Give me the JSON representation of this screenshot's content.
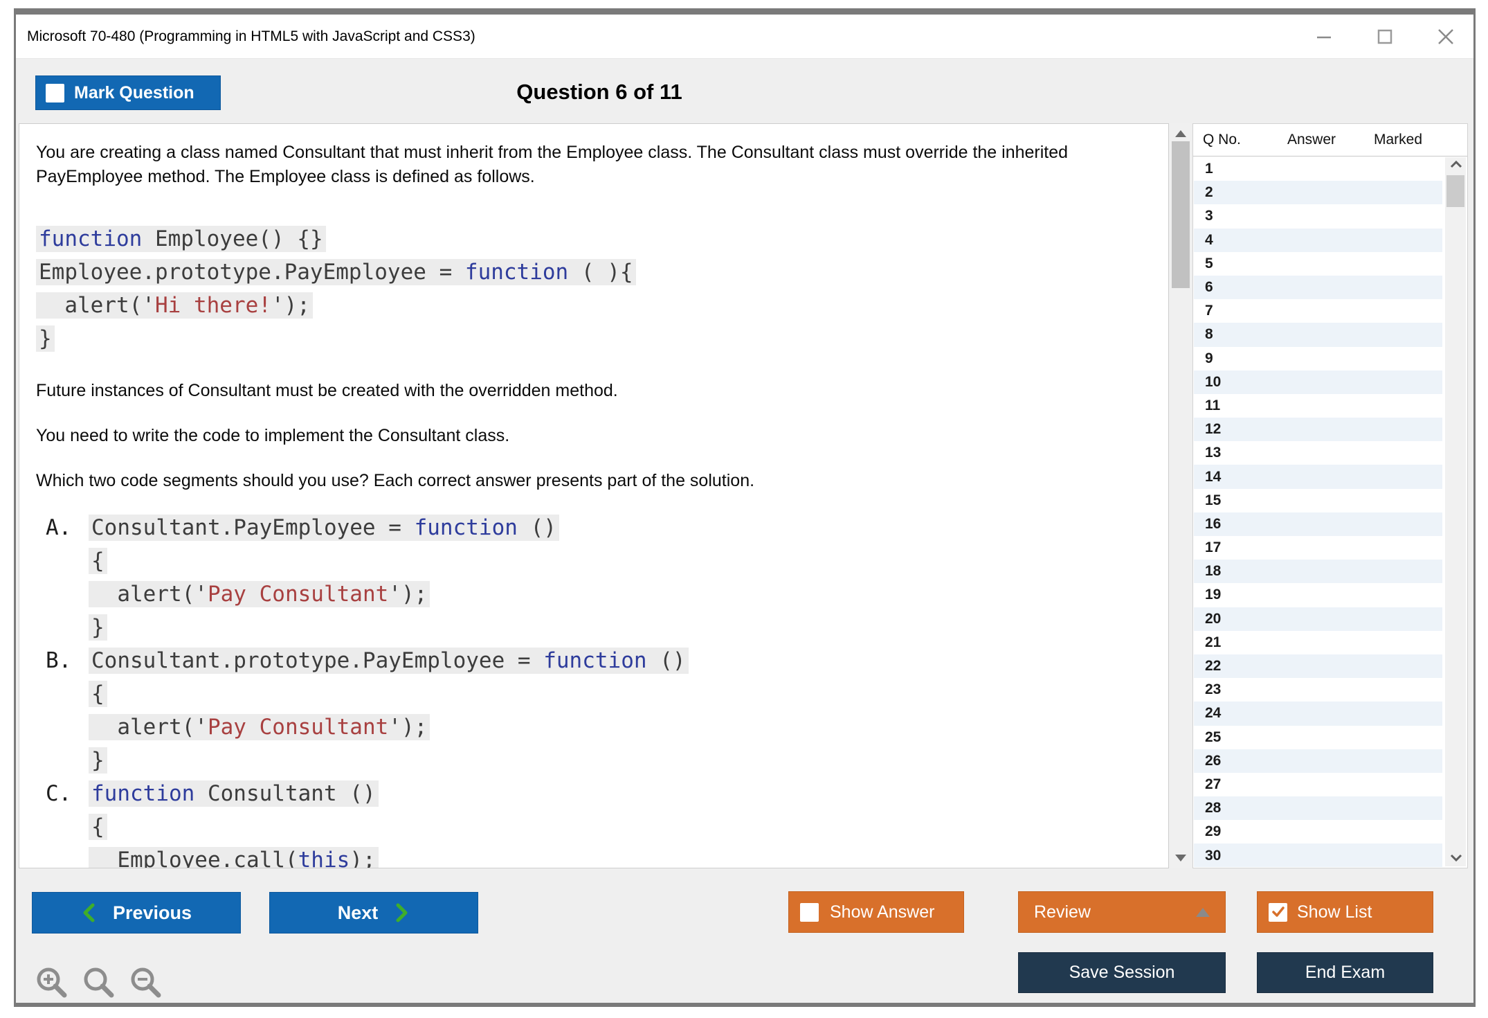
{
  "window": {
    "title": "Microsoft 70-480 (Programming in HTML5 with JavaScript and CSS3)"
  },
  "header": {
    "mark_question": "Mark Question",
    "question_counter": "Question 6 of 11"
  },
  "question": {
    "intro": "You are creating a class named Consultant that must inherit from the Employee class. The Consultant class must override the inherited PayEmployee method. The Employee class is defined as follows.",
    "code": [
      [
        {
          "t": "function",
          "c": "kw"
        },
        {
          "t": " Employee() {}",
          "c": "pl"
        }
      ],
      [
        {
          "t": "Employee.prototype.PayEmployee = ",
          "c": "pl"
        },
        {
          "t": "function",
          "c": "kw"
        },
        {
          "t": " ( ){",
          "c": "pl"
        }
      ],
      [
        {
          "t": "  alert('",
          "c": "pl"
        },
        {
          "t": "Hi there!",
          "c": "str"
        },
        {
          "t": "');",
          "c": "pl"
        }
      ],
      [
        {
          "t": "}",
          "c": "pl"
        }
      ]
    ],
    "para_future": "Future instances of Consultant must be created with the overridden method.",
    "para_need": "You need to write the code to implement the Consultant class.",
    "para_which": "Which two code segments should you use? Each correct answer presents part of the solution.",
    "options": [
      {
        "label": "A.",
        "lines": [
          [
            {
              "t": "Consultant.PayEmployee = ",
              "c": "pl"
            },
            {
              "t": "function",
              "c": "kw"
            },
            {
              "t": " ()",
              "c": "pl"
            }
          ],
          [
            {
              "t": "{",
              "c": "pl"
            }
          ],
          [
            {
              "t": "  alert('",
              "c": "pl"
            },
            {
              "t": "Pay Consultant",
              "c": "str"
            },
            {
              "t": "');",
              "c": "pl"
            }
          ],
          [
            {
              "t": "}",
              "c": "pl"
            }
          ]
        ]
      },
      {
        "label": "B.",
        "lines": [
          [
            {
              "t": "Consultant.prototype.PayEmployee = ",
              "c": "pl"
            },
            {
              "t": "function",
              "c": "kw"
            },
            {
              "t": " ()",
              "c": "pl"
            }
          ],
          [
            {
              "t": "{",
              "c": "pl"
            }
          ],
          [
            {
              "t": "  alert('",
              "c": "pl"
            },
            {
              "t": "Pay Consultant",
              "c": "str"
            },
            {
              "t": "');",
              "c": "pl"
            }
          ],
          [
            {
              "t": "}",
              "c": "pl"
            }
          ]
        ]
      },
      {
        "label": "C.",
        "lines": [
          [
            {
              "t": "function",
              "c": "kw"
            },
            {
              "t": " Consultant ()",
              "c": "pl"
            }
          ],
          [
            {
              "t": "{",
              "c": "pl"
            }
          ],
          [
            {
              "t": "  Employee.call(",
              "c": "pl"
            },
            {
              "t": "this",
              "c": "kw"
            },
            {
              "t": ");",
              "c": "pl"
            }
          ]
        ]
      }
    ]
  },
  "sidebar": {
    "columns": [
      "Q No.",
      "Answer",
      "Marked"
    ],
    "question_numbers": [
      1,
      2,
      3,
      4,
      5,
      6,
      7,
      8,
      9,
      10,
      11,
      12,
      13,
      14,
      15,
      16,
      17,
      18,
      19,
      20,
      21,
      22,
      23,
      24,
      25,
      26,
      27,
      28,
      29,
      30
    ]
  },
  "footer": {
    "previous": "Previous",
    "next": "Next",
    "show_answer": "Show Answer",
    "review": "Review",
    "show_list": "Show List",
    "save_session": "Save Session",
    "end_exam": "End Exam"
  },
  "colors": {
    "accent_blue": "#1268b3",
    "accent_orange": "#d8702b",
    "navy": "#21394f",
    "chevron_green": "#3fae2a",
    "code_keyword": "#2e3c9c",
    "code_string": "#a84040",
    "row_stripe": "#edf3f9"
  }
}
